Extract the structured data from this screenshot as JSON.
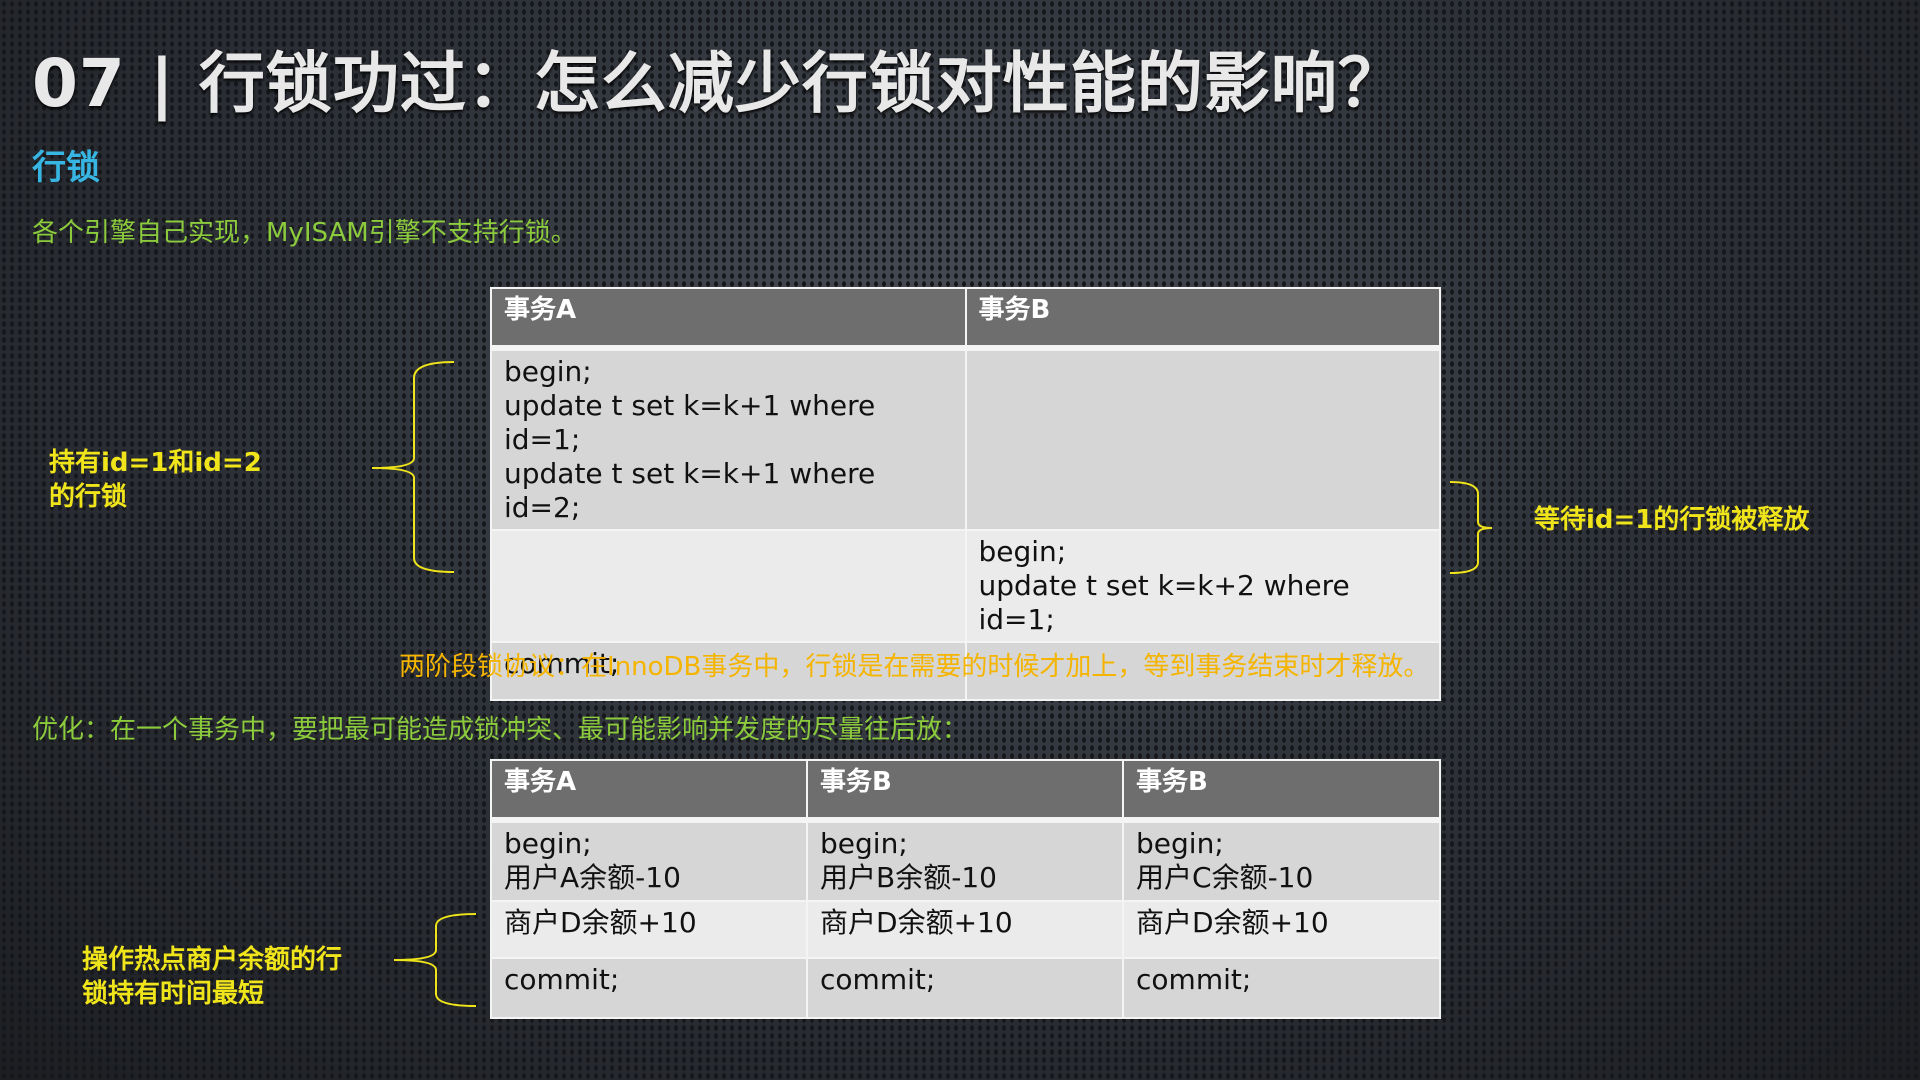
{
  "title": "07 | 行锁功过：怎么减少行锁对性能的影响？",
  "section": "行锁",
  "note1": "各个引擎自己实现，MyISAM引擎不支持行锁。",
  "table1": {
    "headers": [
      "事务A",
      "事务B"
    ],
    "rows": [
      [
        [
          "begin;",
          "update t set k=k+1 where id=1;",
          "update t set k=k+1 where id=2;"
        ],
        []
      ],
      [
        [],
        [
          "begin;",
          "update t set k=k+2 where id=1;"
        ]
      ],
      [
        [
          "commit;"
        ],
        []
      ]
    ]
  },
  "label_left1": [
    "持有id=1和id=2",
    "的行锁"
  ],
  "label_right1": "等待id=1的行锁被释放",
  "two_phase": "两阶段锁协议：在InnoDB事务中，行锁是在需要的时候才加上，等到事务结束时才释放。",
  "optimize": "优化：在一个事务中，要把最可能造成锁冲突、最可能影响并发度的尽量往后放：",
  "table2": {
    "headers": [
      "事务A",
      "事务B",
      "事务B"
    ],
    "rows": [
      [
        [
          "begin;",
          "用户A余额-10"
        ],
        [
          "begin;",
          "用户B余额-10"
        ],
        [
          "begin;",
          "用户C余额-10"
        ]
      ],
      [
        [
          "商户D余额+10"
        ],
        [
          "商户D余额+10"
        ],
        [
          "商户D余额+10"
        ]
      ],
      [
        [
          "commit;"
        ],
        [
          "commit;"
        ],
        [
          "commit;"
        ]
      ]
    ]
  },
  "label_left2": [
    "操作热点商户余额的行",
    "锁持有时间最短"
  ],
  "colors": {
    "title": "#e8e8e8",
    "section": "#38b6e3",
    "green": "#8ccc3c",
    "yellow": "#f0e41a",
    "orange": "#f5b400",
    "header_bg": "#6e6e6e"
  }
}
